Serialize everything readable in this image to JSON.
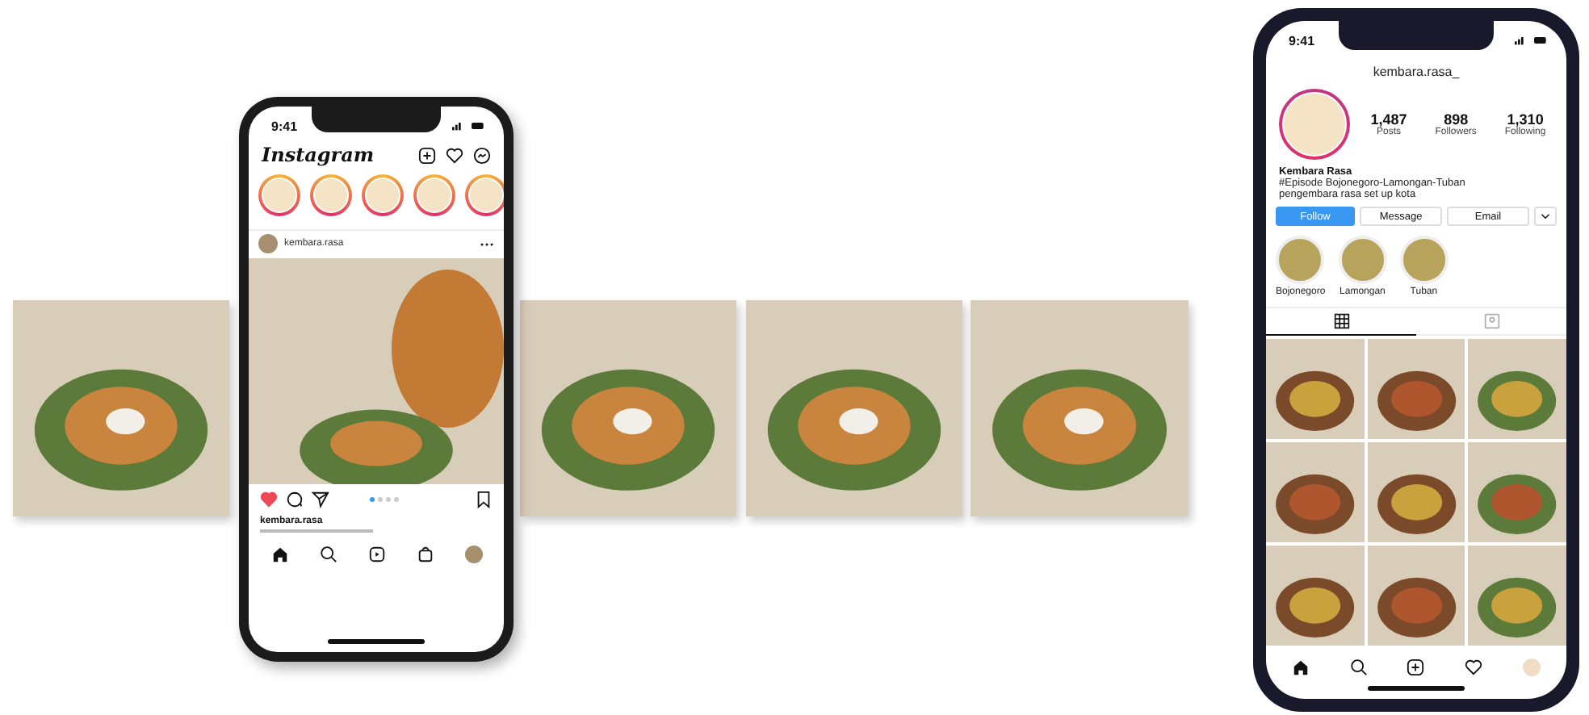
{
  "left_phone": {
    "status_time": "9:41",
    "app_title": "Instagram",
    "post": {
      "username": "kembara.rasa",
      "liked": true,
      "carousel_dots": [
        {
          "selected": true
        },
        {
          "selected": false
        },
        {
          "selected": false
        },
        {
          "selected": false
        }
      ],
      "caption_user": "kembara.rasa"
    }
  },
  "right_phone": {
    "status_time": "9:41",
    "username": "kembara.rasa_",
    "stats": [
      {
        "value": "1,487",
        "label": "Posts"
      },
      {
        "value": "898",
        "label": "Followers"
      },
      {
        "value": "1,310",
        "label": "Following"
      }
    ],
    "name": "Kembara Rasa",
    "bio": [
      "#Episode Bojonegoro-Lamongan-Tuban",
      "pengembara rasa set up kota"
    ],
    "buttons": [
      {
        "label": "Follow",
        "kind": "primary"
      },
      {
        "label": "Message",
        "kind": "secondary"
      },
      {
        "label": "Email",
        "kind": "secondary"
      }
    ],
    "highlights": [
      {
        "label": "Bojonegoro"
      },
      {
        "label": "Lamongan"
      },
      {
        "label": "Tuban"
      }
    ],
    "grid_tabs": [
      {
        "selected": true
      },
      {
        "selected": false
      }
    ]
  }
}
